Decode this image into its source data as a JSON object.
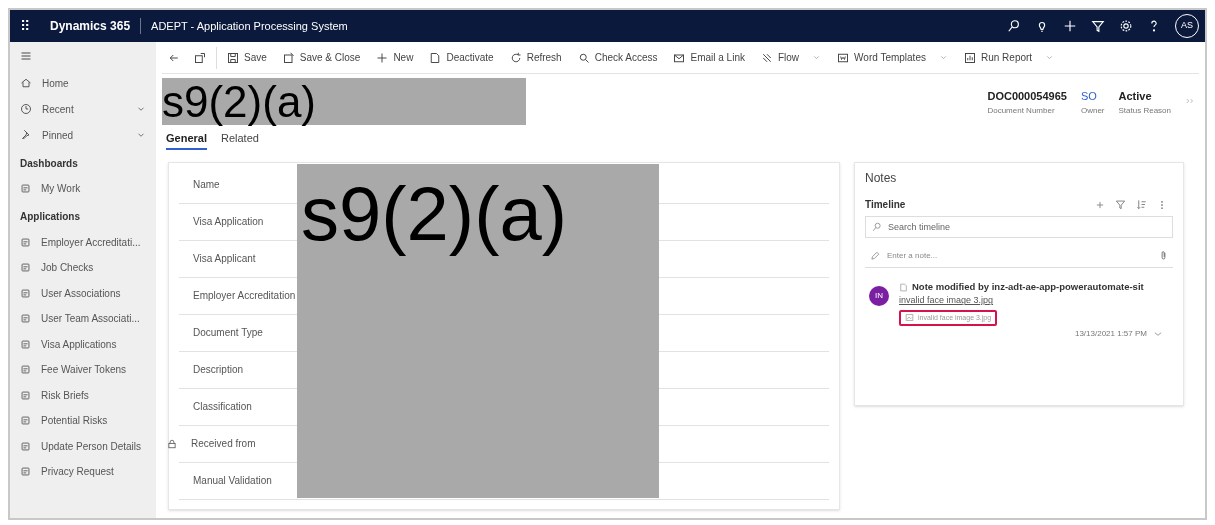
{
  "top_bar": {
    "app_launcher": "⠿",
    "product": "Dynamics 365",
    "app_title": "ADEPT - Application Processing System",
    "avatar": "AS"
  },
  "sidebar": {
    "nav": [
      {
        "label": "Home",
        "chevron": false
      },
      {
        "label": "Recent",
        "chevron": true
      },
      {
        "label": "Pinned",
        "chevron": true
      }
    ],
    "sections": [
      {
        "title": "Dashboards",
        "items": [
          "My Work"
        ]
      },
      {
        "title": "Applications",
        "items": [
          "Employer Accreditati...",
          "Job Checks",
          "User Associations",
          "User Team Associati...",
          "Visa Applications",
          "Fee Waiver Tokens",
          "Risk Briefs",
          "Potential Risks",
          "Update Person Details",
          "Privacy Request"
        ]
      }
    ]
  },
  "command_bar": [
    {
      "label": "Save",
      "dropdown": false
    },
    {
      "label": "Save & Close",
      "dropdown": false
    },
    {
      "label": "New",
      "dropdown": false
    },
    {
      "label": "Deactivate",
      "dropdown": false
    },
    {
      "label": "Refresh",
      "dropdown": false
    },
    {
      "label": "Check Access",
      "dropdown": false
    },
    {
      "label": "Email a Link",
      "dropdown": false
    },
    {
      "label": "Flow",
      "dropdown": true
    },
    {
      "label": "Word Templates",
      "dropdown": true
    },
    {
      "label": "Run Report",
      "dropdown": true
    }
  ],
  "header": {
    "redaction": "s9(2)(a)",
    "fields": [
      {
        "value": "DOC000054965",
        "label": "Document Number",
        "link": false
      },
      {
        "value": "SO",
        "label": "Owner",
        "link": true
      },
      {
        "value": "Active",
        "label": "Status Reason",
        "link": false
      }
    ]
  },
  "tabs": [
    {
      "label": "General",
      "selected": true
    },
    {
      "label": "Related",
      "selected": false
    }
  ],
  "form": {
    "redaction": "s9(2)(a)",
    "fields": [
      {
        "label": "Name",
        "locked": false
      },
      {
        "label": "Visa Application",
        "locked": false
      },
      {
        "label": "Visa Applicant",
        "locked": false
      },
      {
        "label": "Employer Accreditation",
        "locked": false
      },
      {
        "label": "Document Type",
        "locked": false
      },
      {
        "label": "Description",
        "locked": false
      },
      {
        "label": "Classification",
        "locked": false
      },
      {
        "label": "Received from",
        "locked": true
      },
      {
        "label": "Manual Validation",
        "locked": false
      }
    ]
  },
  "notes": {
    "title": "Notes",
    "timeline": "Timeline",
    "search": {
      "placeholder": "Search timeline"
    },
    "note_input": {
      "placeholder": "Enter a note..."
    },
    "entries": [
      {
        "avatar": "IN",
        "title": "Note modified by inz-adt-ae-app-powerautomate-sit",
        "subtitle": "invalid face image 3.jpg",
        "attachment": "invalid face image 3.jpg",
        "attachment_highlighted": true,
        "time": "13/13/2021 1:57 PM"
      }
    ]
  }
}
